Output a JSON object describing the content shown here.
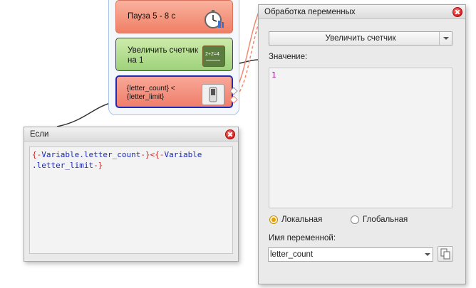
{
  "flow": {
    "blocks": [
      {
        "label": "Пауза 5 - 8 с",
        "icon": "stopwatch-icon"
      },
      {
        "label_line1": "Увеличить счетчик",
        "label_line2": "на 1",
        "icon": "chalkboard-icon"
      },
      {
        "label_line1": "{letter_count} <",
        "label_line2": "{letter_limit}",
        "icon": "switch-icon"
      }
    ]
  },
  "if_dialog": {
    "title": "Если",
    "code_line1_parts": [
      "{-",
      "Variable",
      ".letter_count",
      "-}<",
      "{-",
      "Variable"
    ],
    "code_line2_parts": [
      ".letter_limit",
      "-}"
    ]
  },
  "var_dialog": {
    "title": "Обработка переменных",
    "action": "Увеличить счетчик",
    "value_label": "Значение:",
    "value": "1",
    "scope_local": "Локальная",
    "scope_global": "Глобальная",
    "scope_selected": "local",
    "var_name_label": "Имя переменной:",
    "var_name": "letter_count"
  },
  "colors": {
    "code_brace": "#d42020",
    "code_variable": "#1c2bb8",
    "value_text": "#8a1c8a",
    "accent_radio": "#e8a000"
  }
}
